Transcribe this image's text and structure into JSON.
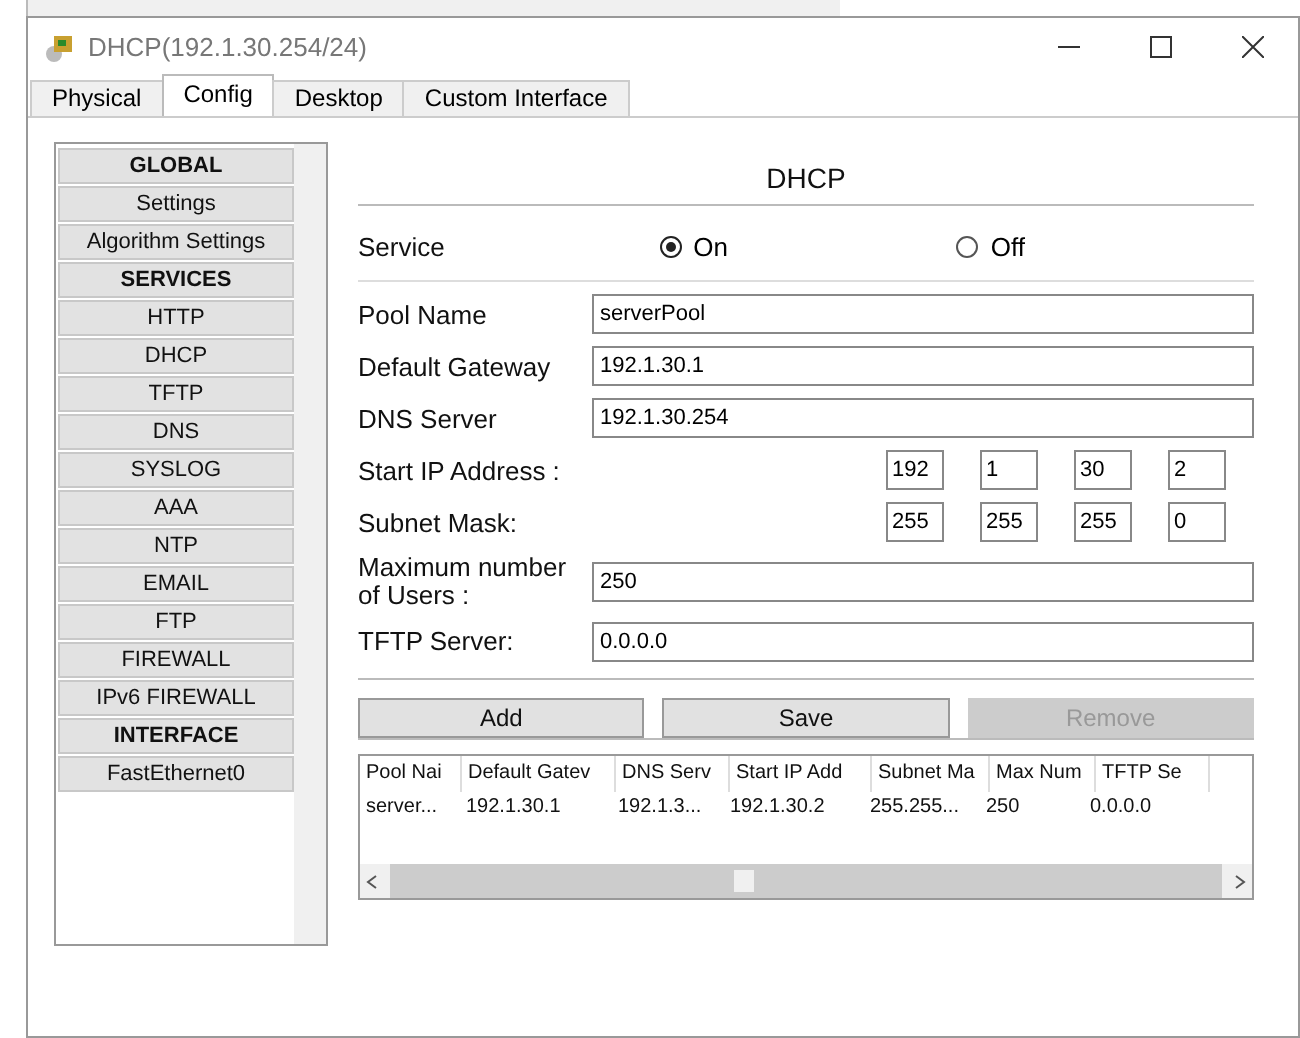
{
  "window": {
    "title": "DHCP(192.1.30.254/24)"
  },
  "tabs": [
    {
      "label": "Physical",
      "selected": false
    },
    {
      "label": "Config",
      "selected": true
    },
    {
      "label": "Desktop",
      "selected": false
    },
    {
      "label": "Custom Interface",
      "selected": false
    }
  ],
  "sidebar": {
    "items": [
      {
        "label": "GLOBAL",
        "kind": "header"
      },
      {
        "label": "Settings",
        "kind": "item"
      },
      {
        "label": "Algorithm Settings",
        "kind": "item"
      },
      {
        "label": "SERVICES",
        "kind": "header"
      },
      {
        "label": "HTTP",
        "kind": "item"
      },
      {
        "label": "DHCP",
        "kind": "item"
      },
      {
        "label": "TFTP",
        "kind": "item"
      },
      {
        "label": "DNS",
        "kind": "item"
      },
      {
        "label": "SYSLOG",
        "kind": "item"
      },
      {
        "label": "AAA",
        "kind": "item"
      },
      {
        "label": "NTP",
        "kind": "item"
      },
      {
        "label": "EMAIL",
        "kind": "item"
      },
      {
        "label": "FTP",
        "kind": "item"
      },
      {
        "label": "FIREWALL",
        "kind": "item"
      },
      {
        "label": "IPv6 FIREWALL",
        "kind": "item"
      },
      {
        "label": "INTERFACE",
        "kind": "header"
      },
      {
        "label": "FastEthernet0",
        "kind": "item"
      }
    ]
  },
  "panel": {
    "title": "DHCP",
    "service": {
      "label": "Service",
      "options": [
        {
          "label": "On",
          "selected": true
        },
        {
          "label": "Off",
          "selected": false
        }
      ]
    },
    "fields": [
      {
        "label": "Pool Name",
        "value": "serverPool"
      },
      {
        "label": "Default Gateway",
        "value": "192.1.30.1"
      },
      {
        "label": "DNS Server",
        "value": "192.1.30.254"
      }
    ],
    "octet_fields": [
      {
        "label": "Start IP Address :",
        "values": [
          "192",
          "1",
          "30",
          "2"
        ]
      },
      {
        "label": "Subnet Mask:",
        "values": [
          "255",
          "255",
          "255",
          "0"
        ]
      }
    ],
    "fields2": [
      {
        "label": "Maximum number of Users :",
        "value": "250"
      },
      {
        "label": "TFTP Server:",
        "value": "0.0.0.0"
      }
    ],
    "buttons": [
      {
        "label": "Add",
        "disabled": false
      },
      {
        "label": "Save",
        "disabled": false
      },
      {
        "label": "Remove",
        "disabled": true
      }
    ],
    "table": {
      "columns": [
        "Pool Nai",
        "Default Gatev",
        "DNS Serv",
        "Start IP Add",
        "Subnet Ma",
        "Max Num",
        "TFTP Se"
      ],
      "rows": [
        [
          "server...",
          "192.1.30.1",
          "192.1.3...",
          "192.1.30.2",
          "255.255...",
          "250",
          "0.0.0.0"
        ]
      ]
    }
  }
}
